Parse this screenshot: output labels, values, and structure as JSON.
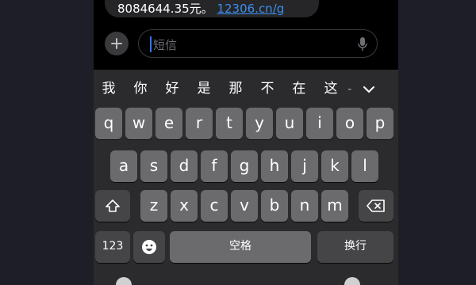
{
  "message": {
    "text": "8084644.35元。",
    "link": "12306.cn/g"
  },
  "compose": {
    "placeholder": "短信"
  },
  "candidates": [
    "我",
    "你",
    "好",
    "是",
    "那",
    "不",
    "在",
    "这"
  ],
  "candidate_more": "-",
  "keys": {
    "row1": [
      "q",
      "w",
      "e",
      "r",
      "t",
      "y",
      "u",
      "i",
      "o",
      "p"
    ],
    "row2": [
      "a",
      "s",
      "d",
      "f",
      "g",
      "h",
      "j",
      "k",
      "l"
    ],
    "row3": [
      "z",
      "x",
      "c",
      "v",
      "b",
      "n",
      "m"
    ],
    "numbers_label": "123",
    "space_label": "空格",
    "return_label": "换行"
  },
  "icons": {
    "attach": "plus-icon",
    "mic": "microphone-icon",
    "shift": "shift-icon",
    "delete": "backspace-icon",
    "emoji": "emoji-icon",
    "collapse": "chevron-down-icon"
  }
}
